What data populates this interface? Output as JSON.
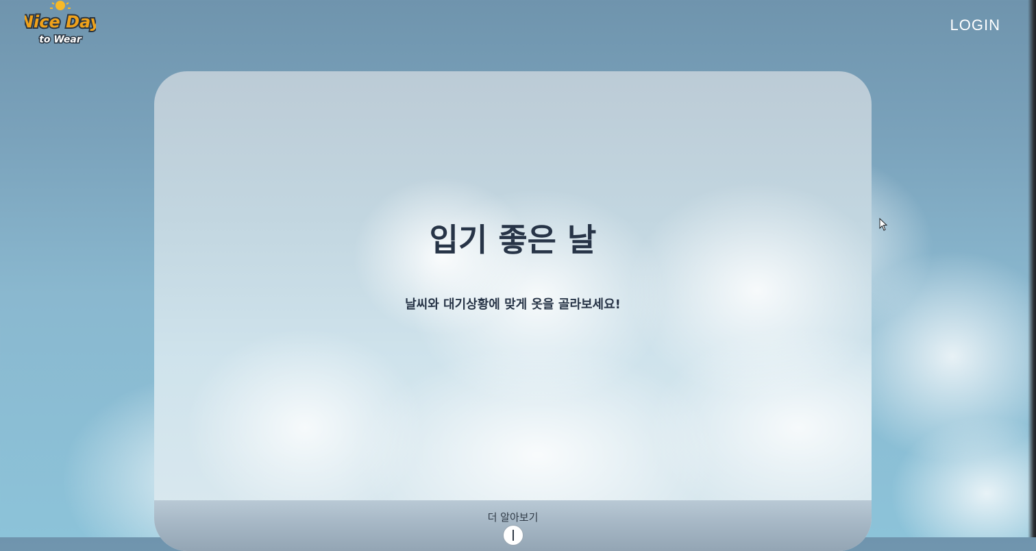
{
  "header": {
    "logo": {
      "line1": "Nice Day",
      "line2": "to Wear",
      "icon": "sun-icon"
    },
    "login_label": "LOGIN"
  },
  "hero": {
    "title": "입기 좋은 날",
    "subtitle": "날씨와 대기상황에 맞게 옷을 골라보세요!",
    "more_label": "더 알아보기",
    "more_icon": "arrow-down-circle-icon"
  },
  "colors": {
    "text_dark": "#273447",
    "logo_orange": "#f0a21a",
    "logo_outline": "#2b3642",
    "sky": "#7aa2bb"
  }
}
